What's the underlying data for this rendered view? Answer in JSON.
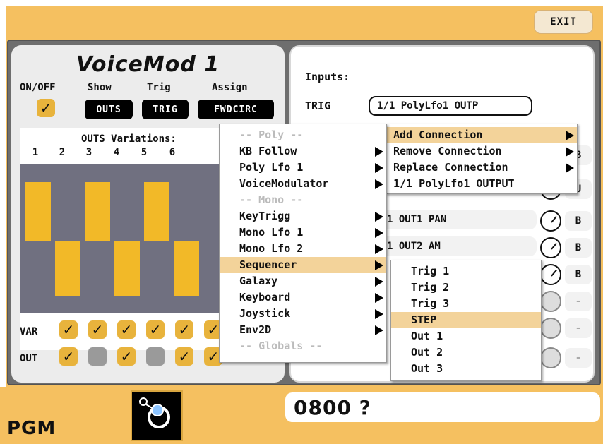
{
  "app": {
    "exit_label": "EXIT",
    "pgm_label": "PGM",
    "preset_code": "0800 ?"
  },
  "module": {
    "title": "VoiceMod 1",
    "onoff_label": "ON/OFF",
    "show_label": "Show",
    "trig_label": "Trig",
    "assign_label": "Assign",
    "show_button": "OUTS",
    "trig_button": "TRIG",
    "assign_button": "FWDCIRC",
    "variations_header": "OUTS Variations:",
    "columns": [
      "1",
      "2",
      "3",
      "4",
      "5",
      "6"
    ],
    "var_label": "VAR",
    "out_label": "OUT",
    "var_states": [
      true,
      true,
      true,
      true,
      true,
      true
    ],
    "out_states": [
      true,
      false,
      true,
      false,
      true,
      true
    ],
    "bar_levels": [
      "high",
      "low",
      "high",
      "low",
      "high",
      "low"
    ]
  },
  "inputs": {
    "header": "Inputs:",
    "trig_label": "TRIG",
    "trig_value": "1/1   PolyLfo1 OUTP"
  },
  "source_menu": {
    "items": [
      {
        "label": "-- Poly --",
        "disabled": true,
        "submenu": false
      },
      {
        "label": "KB Follow",
        "disabled": false,
        "submenu": true
      },
      {
        "label": "Poly Lfo 1",
        "disabled": false,
        "submenu": true
      },
      {
        "label": "VoiceModulator",
        "disabled": false,
        "submenu": true
      },
      {
        "label": "-- Mono --",
        "disabled": true,
        "submenu": false
      },
      {
        "label": "KeyTrigg",
        "disabled": false,
        "submenu": true
      },
      {
        "label": "Mono Lfo 1",
        "disabled": false,
        "submenu": true
      },
      {
        "label": "Mono Lfo 2",
        "disabled": false,
        "submenu": true
      },
      {
        "label": "Sequencer",
        "disabled": false,
        "submenu": true,
        "selected": true
      },
      {
        "label": "Galaxy",
        "disabled": false,
        "submenu": true
      },
      {
        "label": "Keyboard",
        "disabled": false,
        "submenu": true
      },
      {
        "label": "Joystick",
        "disabled": false,
        "submenu": true
      },
      {
        "label": "Env2D",
        "disabled": false,
        "submenu": true
      },
      {
        "label": "-- Globals --",
        "disabled": true,
        "submenu": false
      }
    ]
  },
  "connection_menu": {
    "items": [
      {
        "label": "Add Connection",
        "submenu": true,
        "selected": true
      },
      {
        "label": "Remove Connection",
        "submenu": true
      },
      {
        "label": "Replace Connection",
        "submenu": true
      },
      {
        "label": "1/1    PolyLfo1 OUTPUT",
        "submenu": false
      }
    ]
  },
  "sequencer_menu": {
    "items": [
      {
        "label": "Trig 1"
      },
      {
        "label": "Trig 2"
      },
      {
        "label": "Trig 3"
      },
      {
        "label": "STEP",
        "selected": true
      },
      {
        "label": "Out 1"
      },
      {
        "label": "Out 2"
      },
      {
        "label": "Out 3"
      }
    ]
  },
  "outputs": {
    "rows": [
      {
        "label": "1   OUT1 PAN",
        "side": "B"
      },
      {
        "label": "1   OUT2 AM",
        "side": "B"
      }
    ],
    "side_values": [
      "B",
      "U",
      "B",
      "B",
      "B",
      "-",
      "-",
      "-"
    ]
  }
}
